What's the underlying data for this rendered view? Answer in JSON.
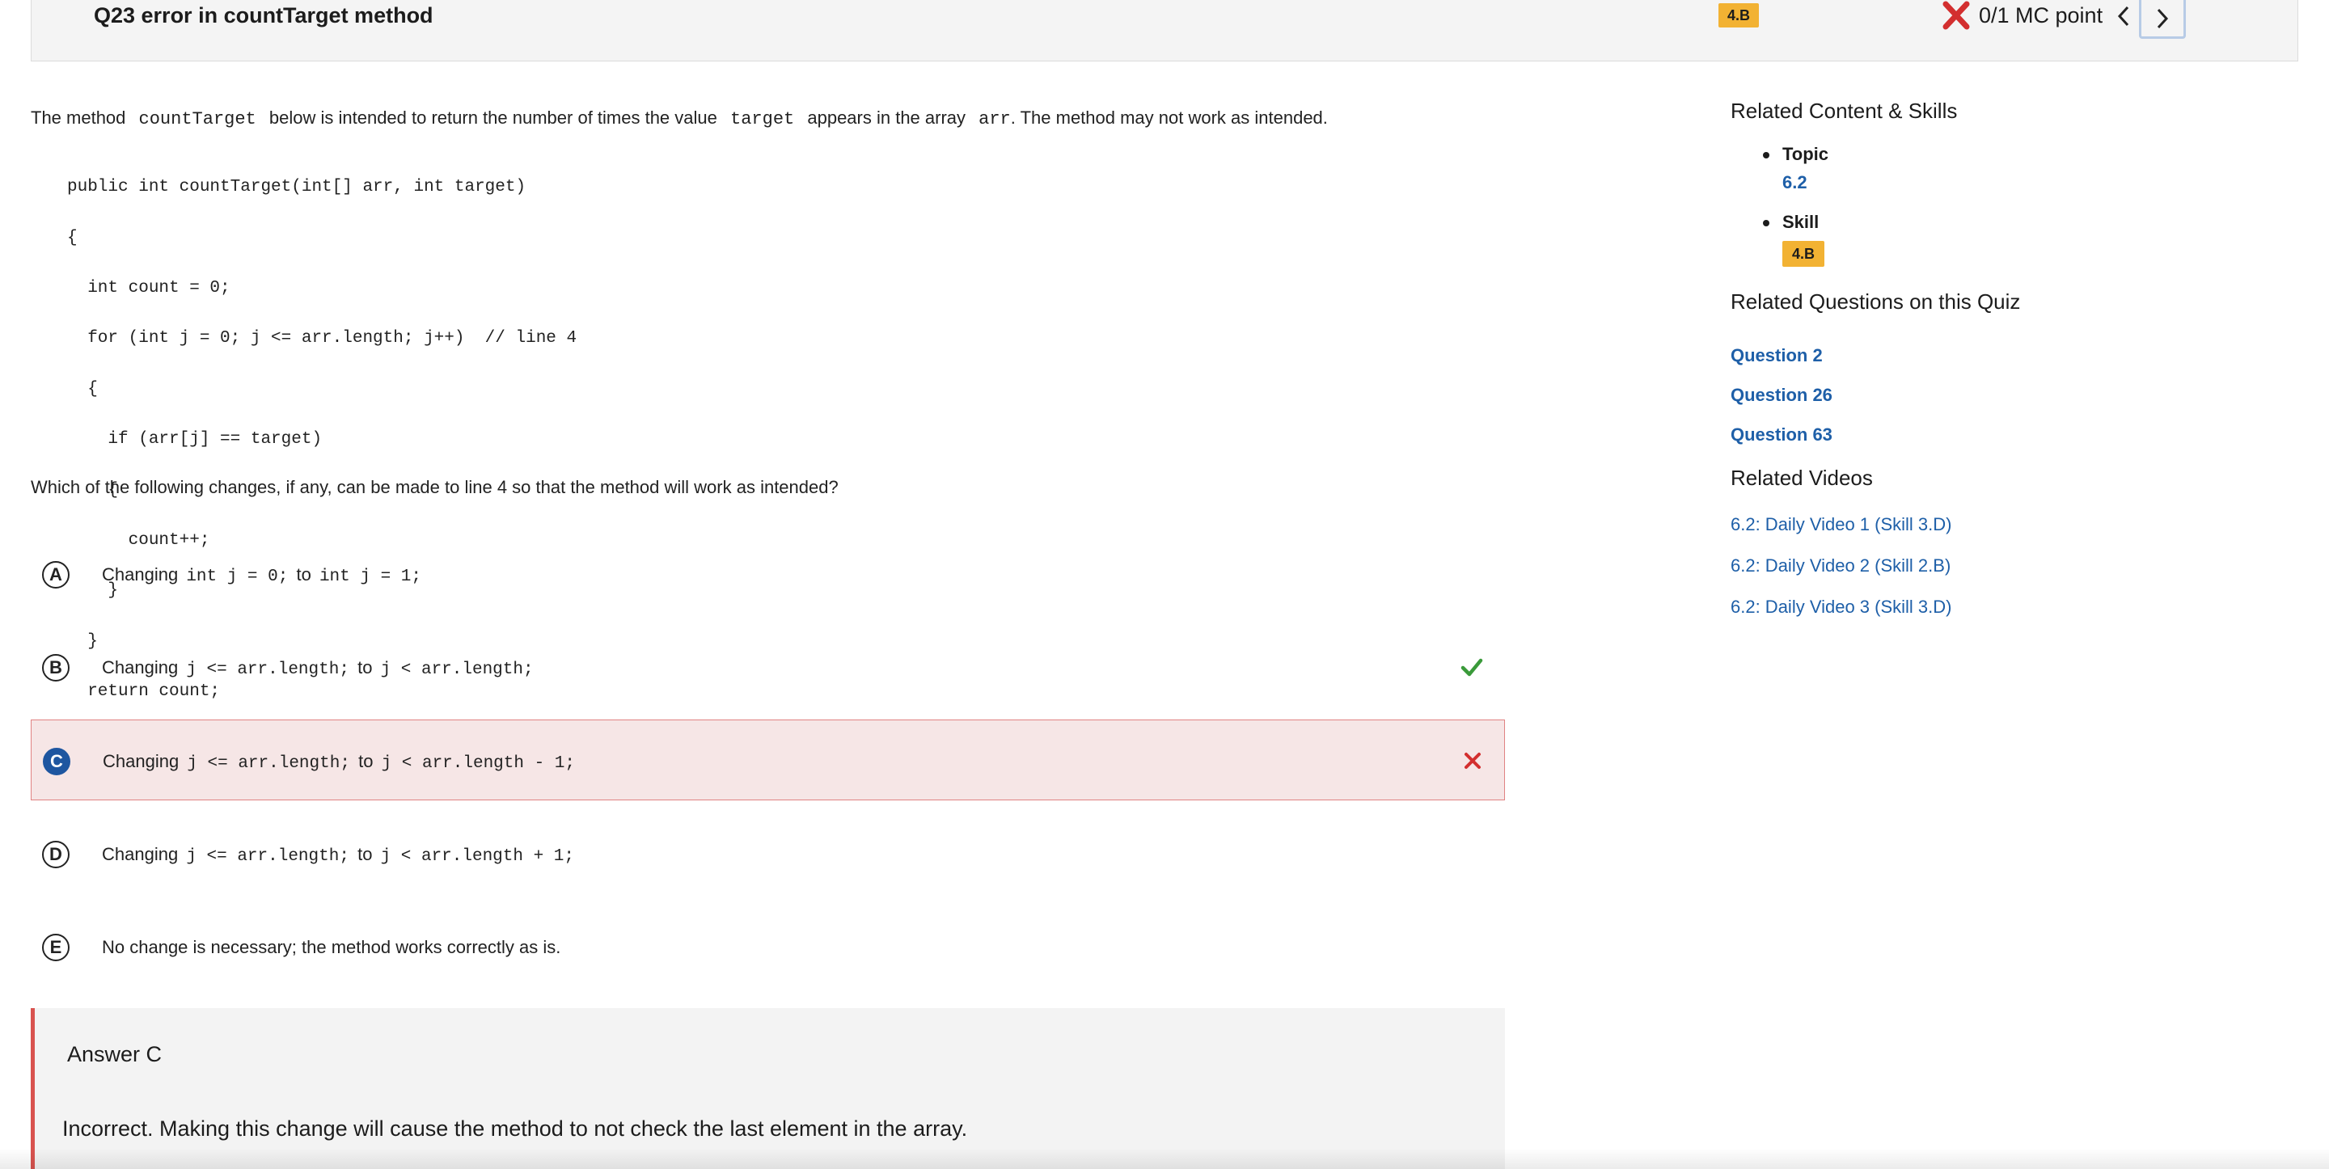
{
  "header": {
    "title": "Q23 error in countTarget method",
    "skill_badge": "4.B",
    "score_text": "0/1 MC point",
    "colors": {
      "badge": "#f2b233",
      "incorrect": "#d32f2f",
      "correct": "#3a9a3a",
      "link": "#1e5fa8",
      "selected": "#1e56a0"
    }
  },
  "question": {
    "prompt_part1": "The method",
    "prompt_code1": "countTarget",
    "prompt_part2": "below is intended to return the number of times the value",
    "prompt_code2": "target",
    "prompt_part3": "appears in the array",
    "prompt_code3": "arr",
    "prompt_part4": ". The method may not work as intended.",
    "code_lines": [
      "public int countTarget(int[] arr, int target)",
      "{",
      "  int count = 0;",
      "  for (int j = 0; j <= arr.length; j++)  // line 4",
      "  {",
      "    if (arr[j] == target)",
      "    {",
      "      count++;",
      "    }",
      "  }",
      "  return count;",
      "}"
    ],
    "question_text": "Which of the following changes, if any, can be made to line 4 so that the method will work as intended?"
  },
  "choices": [
    {
      "letter": "A",
      "prefix": "Changing",
      "code_from": "int j = 0;",
      "mid": "to",
      "code_to": "int j = 1;",
      "mark": ""
    },
    {
      "letter": "B",
      "prefix": "Changing",
      "code_from": "j <= arr.length;",
      "mid": "to",
      "code_to": "j < arr.length;",
      "mark": "correct"
    },
    {
      "letter": "C",
      "prefix": "Changing",
      "code_from": "j <= arr.length;",
      "mid": "to",
      "code_to": "j < arr.length - 1;",
      "mark": "incorrect"
    },
    {
      "letter": "D",
      "prefix": "Changing",
      "code_from": "j <= arr.length;",
      "mid": "to",
      "code_to": "j < arr.length + 1;",
      "mark": ""
    },
    {
      "letter": "E",
      "text": "No change is necessary; the method works correctly as is.",
      "mark": ""
    }
  ],
  "answer": {
    "title": "Answer C",
    "explanation": "Incorrect. Making this change will cause the method to not check the last element in the array."
  },
  "sidebar": {
    "related_heading": "Related Content & Skills",
    "topic_label": "Topic",
    "topic_value": "6.2",
    "skill_label": "Skill",
    "skill_value": "4.B",
    "questions_heading": "Related Questions on this Quiz",
    "questions": [
      "Question 2",
      "Question 26",
      "Question 63"
    ],
    "videos_heading": "Related Videos",
    "videos": [
      "6.2: Daily Video 1 (Skill 3.D)",
      "6.2: Daily Video 2 (Skill 2.B)",
      "6.2: Daily Video 3 (Skill 3.D)"
    ]
  }
}
